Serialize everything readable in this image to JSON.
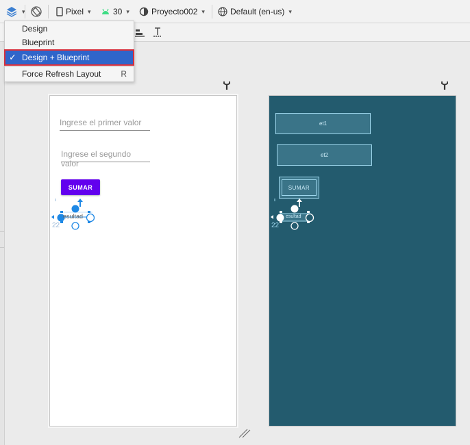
{
  "toolbar": {
    "device": "Pixel",
    "api_level": "30",
    "theme": "Proyecto002",
    "locale": "Default (en-us)"
  },
  "view_menu": {
    "items": [
      {
        "label": "Design"
      },
      {
        "label": "Blueprint"
      },
      {
        "label": "Design + Blueprint",
        "selected": true
      },
      {
        "label": "Force Refresh Layout",
        "shortcut": "R"
      }
    ]
  },
  "design_view": {
    "first_hint": "Ingrese el primer valor",
    "second_hint": "Ingrese el segundo valor",
    "button_label": "SUMAR",
    "result_text": "esultad",
    "result_dim_label": "22"
  },
  "blueprint_view": {
    "et1_label": "et1",
    "et2_label": "et2",
    "button_label": "SUMAR",
    "result_label": "esultad",
    "result_dim_label": "22"
  },
  "colors": {
    "accent": "#6200ee",
    "blueprint_bg": "#235b6e",
    "menu_selection": "#2f65ca",
    "highlight_border": "#d9303c",
    "constraint_blue": "#1e88e5"
  }
}
